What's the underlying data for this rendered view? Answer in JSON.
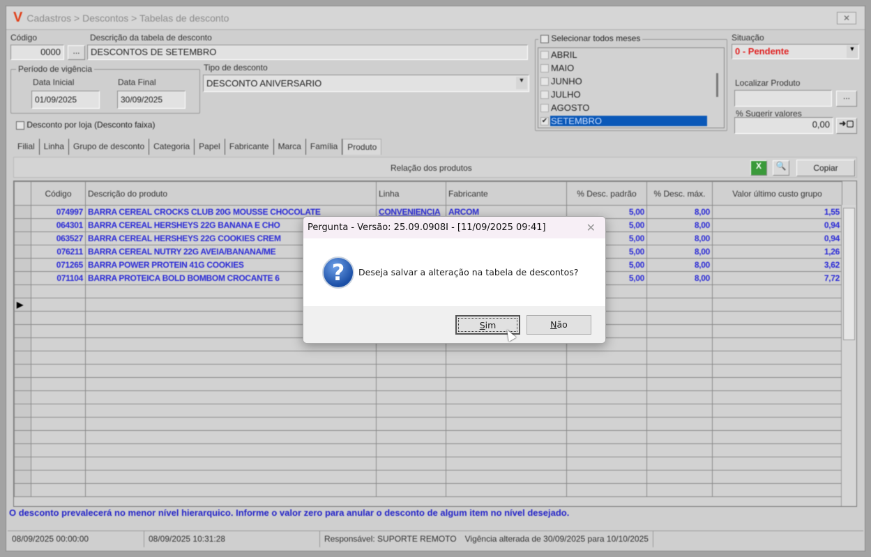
{
  "window": {
    "title": "Cadastros > Descontos > Tabelas de desconto",
    "logo": "V"
  },
  "form": {
    "codigo_label": "Código",
    "codigo_value": "0000",
    "codigo_btn": "...",
    "descricao_label": "Descrição da tabela de desconto",
    "descricao_value": "DESCONTOS DE SETEMBRO",
    "periodo_label": "Período de vigência",
    "data_inicial_label": "Data Inicial",
    "data_inicial_value": "01/09/2025",
    "data_final_label": "Data Final",
    "data_final_value": "30/09/2025",
    "tipo_label": "Tipo de desconto",
    "tipo_value": "DESCONTO ANIVERSARIO",
    "desconto_loja_label": "Desconto por loja (Desconto faixa)",
    "selecionar_meses_label": "Selecionar todos meses",
    "months": [
      {
        "label": "ABRIL",
        "checked": false
      },
      {
        "label": "MAIO",
        "checked": false
      },
      {
        "label": "JUNHO",
        "checked": false
      },
      {
        "label": "JULHO",
        "checked": false
      },
      {
        "label": "AGOSTO",
        "checked": false
      },
      {
        "label": "SETEMBRO",
        "checked": true
      }
    ],
    "situacao_label": "Situação",
    "situacao_value": "0 - Pendente",
    "localizar_label": "Localizar Produto",
    "localizar_value": "",
    "localizar_btn": "...",
    "sugerir_label": "% Sugerir valores",
    "sugerir_value": "0,00"
  },
  "tabs": [
    "Filial",
    "Linha",
    "Grupo de desconto",
    "Categoria",
    "Papel",
    "Fabricante",
    "Marca",
    "Família",
    "Produto"
  ],
  "active_tab": "Produto",
  "grid": {
    "title": "Relação dos produtos",
    "copy_label": "Copiar",
    "columns": [
      "Código",
      "Descrição do produto",
      "Linha",
      "Fabricante",
      "% Desc. padrão",
      "% Desc. máx.",
      "Valor último custo grupo"
    ],
    "rows": [
      [
        "074997",
        "BARRA CEREAL CROCKS CLUB 20G MOUSSE CHOCOLATE",
        "CONVENIENCIA",
        "ARCOM",
        "5,00",
        "8,00",
        "1,55"
      ],
      [
        "064301",
        "BARRA CEREAL HERSHEYS 22G BANANA E CHO",
        "",
        "",
        "5,00",
        "8,00",
        "0,94"
      ],
      [
        "063527",
        "BARRA CEREAL HERSHEYS 22G COOKIES CREM",
        "",
        "",
        "5,00",
        "8,00",
        "0,94"
      ],
      [
        "076211",
        "BARRA CEREAL NUTRY 22G AVEIA/BANANA/ME",
        "",
        "",
        "5,00",
        "8,00",
        "1,26"
      ],
      [
        "071265",
        "BARRA POWER PROTEIN 41G COOKIES",
        "",
        "",
        "5,00",
        "8,00",
        "3,62"
      ],
      [
        "071104",
        "BARRA PROTEICA BOLD BOMBOM CROCANTE 6",
        "",
        "",
        "5,00",
        "8,00",
        "7,72"
      ]
    ]
  },
  "note": "O desconto prevalecerá no menor nível hierarquico. Informe o valor zero para anular o desconto de algum item no nível desejado.",
  "status": [
    "08/09/2025 00:00:00",
    "08/09/2025 10:31:28",
    "Responsável: SUPORTE REMOTO",
    "Vigência alterada de 30/09/2025 para 10/10/2025"
  ],
  "dialog": {
    "title": "Pergunta - Versão: 25.09.0908I - [11/09/2025 09:41]",
    "message": "Deseja salvar a alteração na tabela de descontos?",
    "yes_underline": "S",
    "yes_rest": "im",
    "no_underline": "N",
    "no_rest": "ão",
    "icon": "question-icon"
  },
  "colors": {
    "pending": "#e02020",
    "grid_text": "#2b2bd6",
    "selection": "#0a58b8"
  }
}
